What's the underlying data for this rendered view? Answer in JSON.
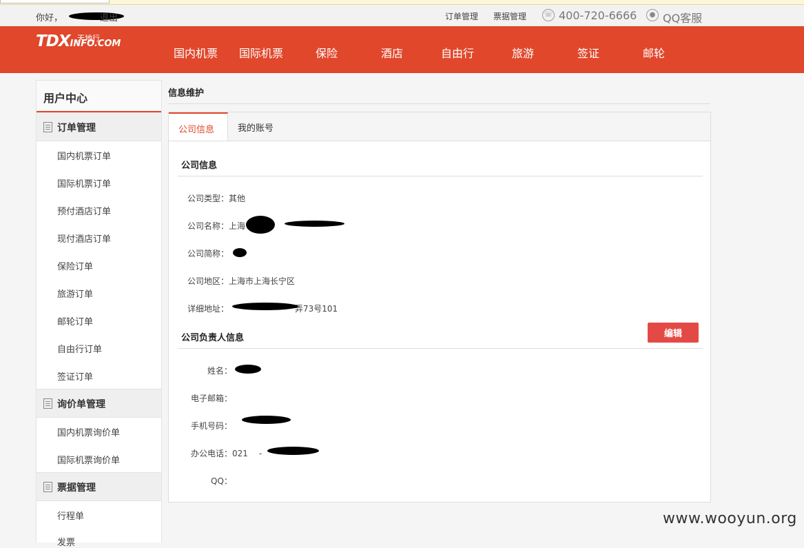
{
  "top": {
    "greeting": "你好，",
    "logout": "退出",
    "links": [
      "订单管理",
      "票据管理"
    ],
    "phone": "400-720-6666",
    "qq_service": "QQ客服"
  },
  "brand": {
    "logo_text": "TDX",
    "logo_suffix": "INFO.COM",
    "logo_cn": "天地行"
  },
  "nav": [
    "国内机票",
    "国际机票",
    "保险",
    "酒店",
    "自由行",
    "旅游",
    "签证",
    "邮轮"
  ],
  "sidebar": {
    "title": "用户中心",
    "groups": [
      {
        "label": "订单管理",
        "items": [
          "国内机票订单",
          "国际机票订单",
          "预付酒店订单",
          "现付酒店订单",
          "保险订单",
          "旅游订单",
          "邮轮订单",
          "自由行订单",
          "签证订单"
        ]
      },
      {
        "label": "询价单管理",
        "items": [
          "国内机票询价单",
          "国际机票询价单"
        ]
      },
      {
        "label": "票据管理",
        "items": [
          "行程单",
          "发票"
        ]
      }
    ]
  },
  "main": {
    "page_title": "信息维护",
    "tabs": [
      "公司信息",
      "我的账号"
    ],
    "company_section": "公司信息",
    "company_fields": [
      {
        "label": "公司类型：",
        "value": "其他"
      },
      {
        "label": "公司名称：",
        "value": "上海"
      },
      {
        "label": "公司简称：",
        "value": ""
      },
      {
        "label": "公司地区：",
        "value": "上海市上海长宁区"
      },
      {
        "label": "详细地址：",
        "value": "弄73号101"
      }
    ],
    "person_section": "公司负责人信息",
    "edit_label": "编辑",
    "person_fields": [
      {
        "label": "姓名：",
        "value": ""
      },
      {
        "label": "电子邮箱：",
        "value": ""
      },
      {
        "label": "手机号码：",
        "value": ""
      },
      {
        "label": "办公电话：",
        "value": "021"
      },
      {
        "label": "QQ：",
        "value": ""
      }
    ],
    "phone_sep": "-"
  },
  "watermark": "www.wooyun.org",
  "colors": {
    "brand": "#e0472b",
    "button": "#e44a45"
  }
}
